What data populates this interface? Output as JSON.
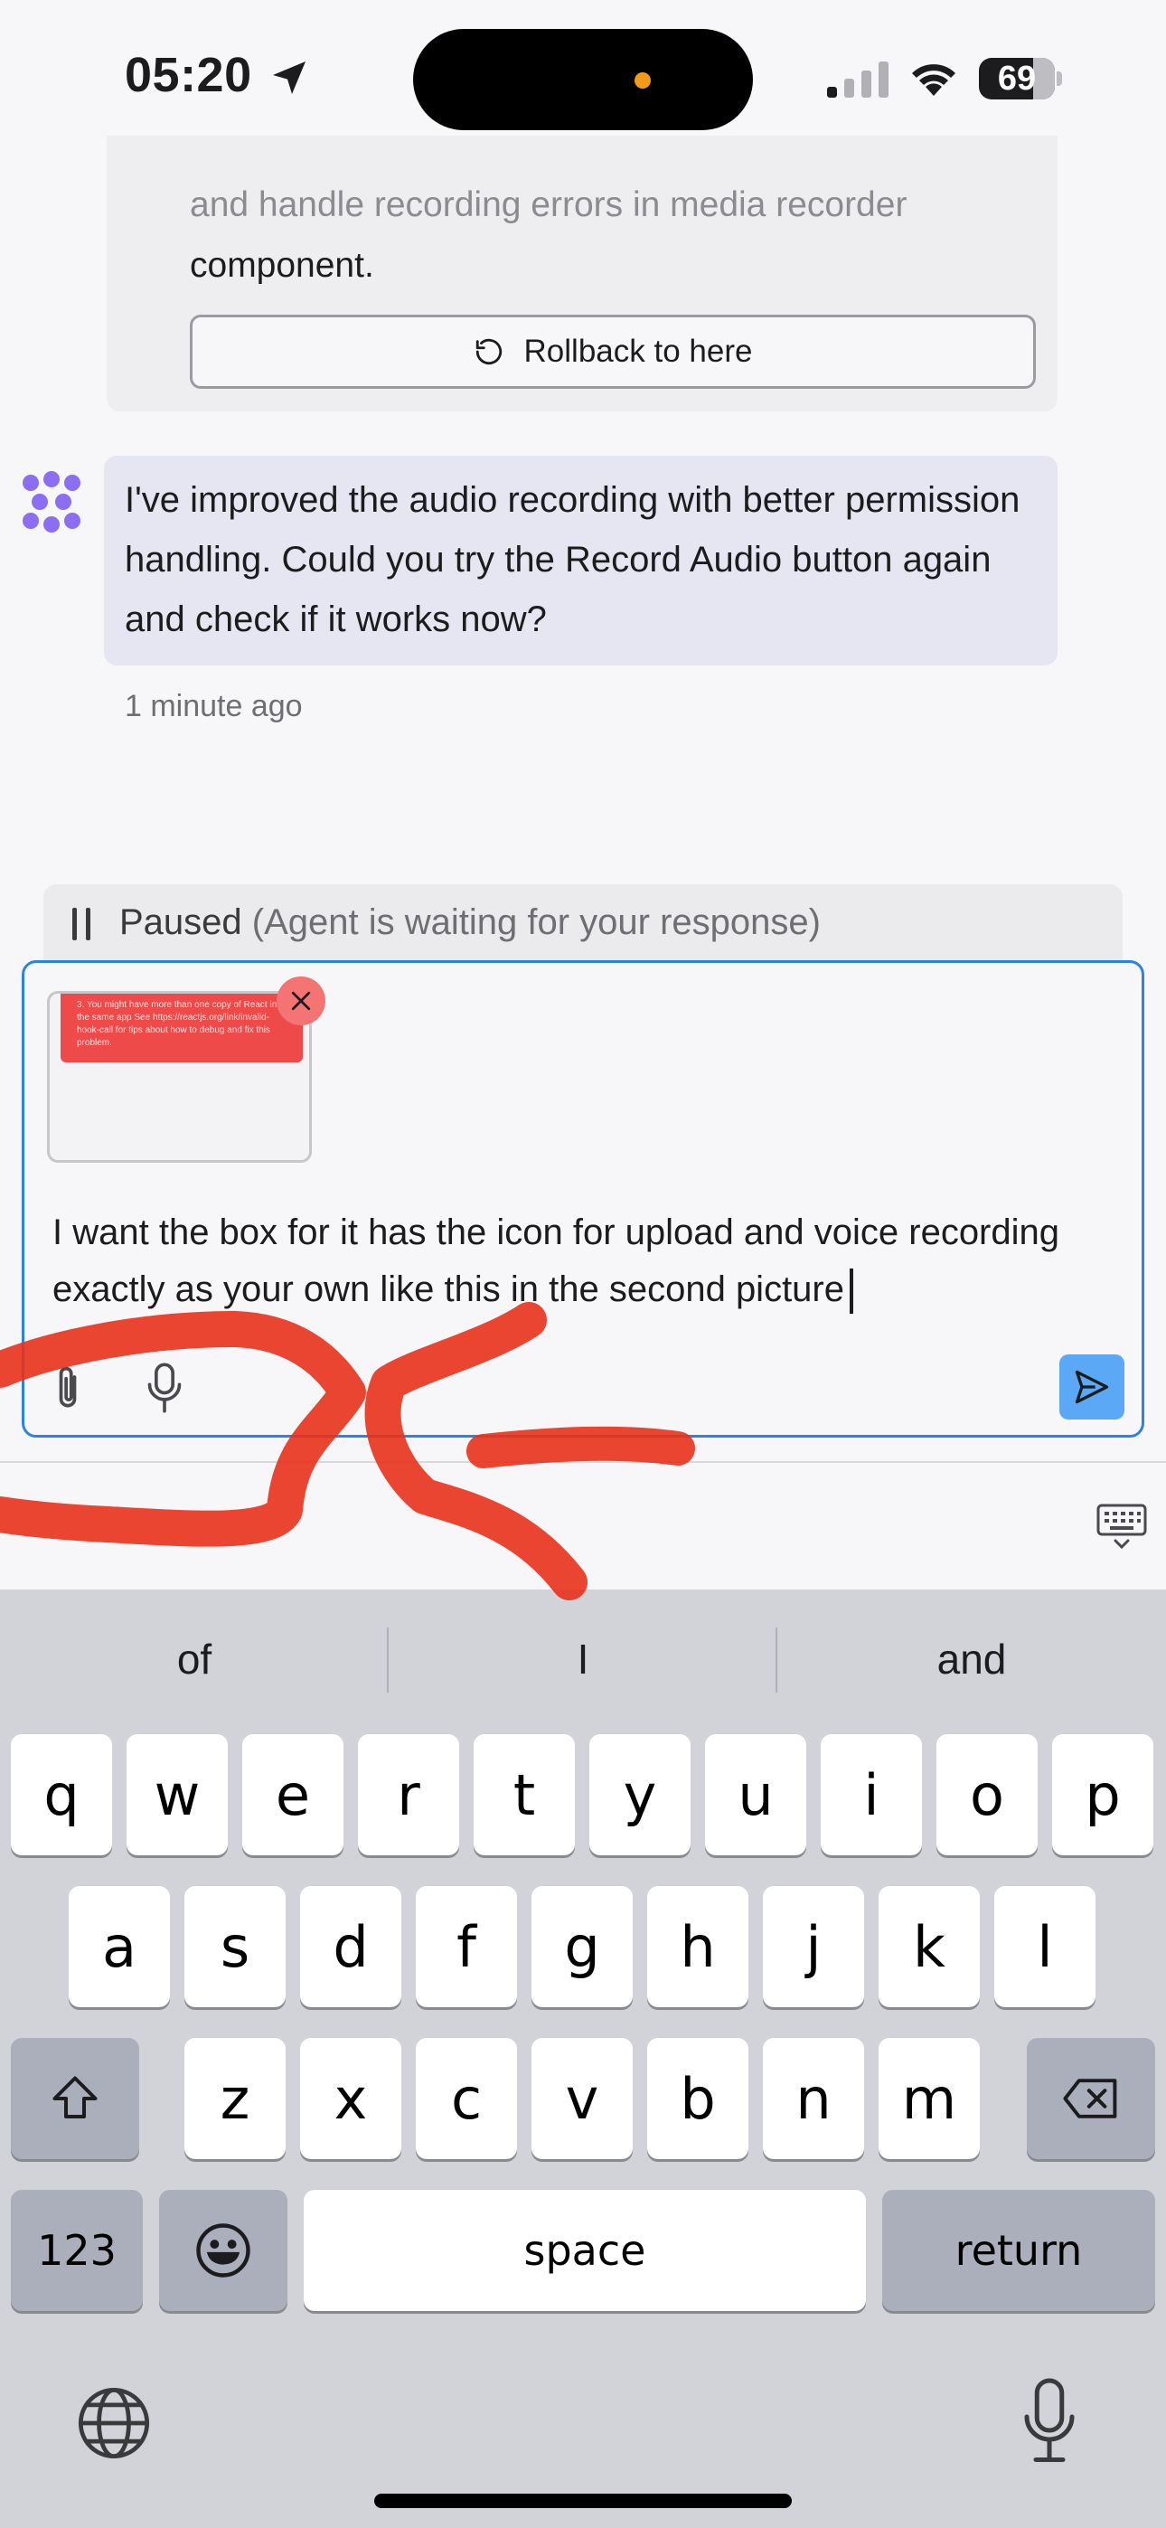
{
  "status_bar": {
    "time": "05:20",
    "battery_level": "69"
  },
  "chat": {
    "previous_message": {
      "faded_line": "and handle recording errors in media recorder",
      "last_line": "component.",
      "rollback_label": "Rollback to here"
    },
    "agent_message": {
      "text": "I've improved the audio recording with better permission handling. Could you try the Record Audio button again and check if it works now?",
      "time": "1 minute ago"
    }
  },
  "paused": {
    "label": "Paused",
    "note": "(Agent is waiting for your response)"
  },
  "composer": {
    "attachment_preview_text": "3. You might have more than one copy of React in the same app See https://reactjs.org/link/invalid-hook-call for tips about how to debug and fix this problem.",
    "input_text": "I want the box for it has the icon for upload and voice recording exactly as your own like this in the second picture"
  },
  "keyboard": {
    "suggestions": [
      "of",
      "I",
      "and"
    ],
    "row1": [
      "q",
      "w",
      "e",
      "r",
      "t",
      "y",
      "u",
      "i",
      "o",
      "p"
    ],
    "row2": [
      "a",
      "s",
      "d",
      "f",
      "g",
      "h",
      "j",
      "k",
      "l"
    ],
    "row3": [
      "z",
      "x",
      "c",
      "v",
      "b",
      "n",
      "m"
    ],
    "numbers_label": "123",
    "space_label": "space",
    "return_label": "return"
  },
  "colors": {
    "accent": "#2c84e0",
    "send_button": "#5aa8f6",
    "error": "#ef4a4a",
    "scribble": "#e8321c"
  },
  "icons": {
    "location": "location-arrow-icon",
    "rollback": "rotate-ccw-icon",
    "pause": "pause-icon",
    "attach": "paperclip-icon",
    "mic": "microphone-icon",
    "send": "send-icon",
    "keyboard_toggle": "keyboard-icon"
  }
}
